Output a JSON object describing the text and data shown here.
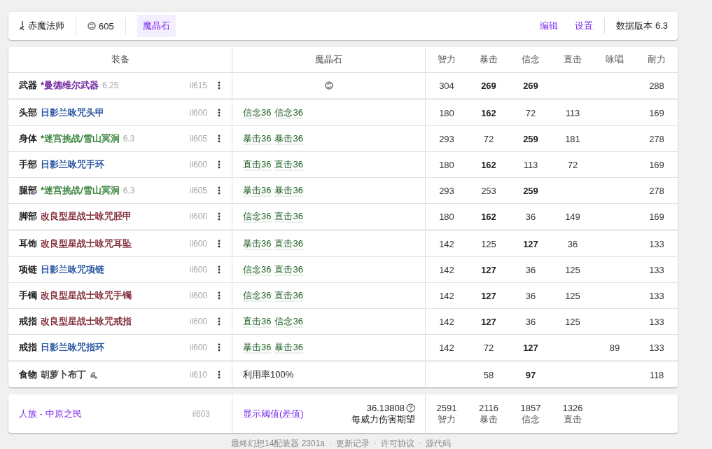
{
  "header": {
    "job": "赤魔法师",
    "item_level": "605",
    "tabs": [
      {
        "label": "魔晶石",
        "selected": true
      }
    ],
    "links": [
      "编辑",
      "设置"
    ],
    "data_version": "数据版本 6.3"
  },
  "table": {
    "columns": [
      "装备",
      "魔晶石",
      "智力",
      "暴击",
      "信念",
      "直击",
      "咏唱",
      "耐力"
    ],
    "groups": [
      [
        {
          "slot": "武器",
          "name": "*曼德维尔武器",
          "patch": "6.25",
          "color": "#6a1b9a",
          "hq": false,
          "ilvl": "il615",
          "materia": {
            "kind": "slot-icon"
          },
          "stats": {
            "intelligence": {
              "value": "304",
              "capped": false
            },
            "critical_hit": {
              "value": "269",
              "capped": true
            },
            "determination": {
              "value": "269",
              "capped": true
            },
            "vitality": {
              "value": "288",
              "capped": false
            }
          }
        }
      ],
      [
        {
          "slot": "头部",
          "name": "日影兰咏咒头甲",
          "color": "#1a4a9c",
          "hq": false,
          "ilvl": "il600",
          "materia": {
            "kind": "melds",
            "melds": [
              "信念36",
              "信念36"
            ]
          },
          "stats": {
            "intelligence": {
              "value": "180",
              "capped": false
            },
            "critical_hit": {
              "value": "162",
              "capped": true
            },
            "determination": {
              "value": "72",
              "capped": false
            },
            "direct_hit": {
              "value": "113",
              "capped": false
            },
            "vitality": {
              "value": "169",
              "capped": false
            }
          }
        },
        {
          "slot": "身体",
          "name": "*迷宫挑战/雪山冥洞",
          "patch": "6.3",
          "color": "#2e7d32",
          "hq": false,
          "ilvl": "il605",
          "materia": {
            "kind": "melds",
            "melds": [
              "暴击36",
              "暴击36"
            ]
          },
          "stats": {
            "intelligence": {
              "value": "293",
              "capped": false
            },
            "critical_hit": {
              "value": "72",
              "capped": false
            },
            "determination": {
              "value": "259",
              "capped": true
            },
            "direct_hit": {
              "value": "181",
              "capped": false
            },
            "vitality": {
              "value": "278",
              "capped": false
            }
          }
        },
        {
          "slot": "手部",
          "name": "日影兰咏咒手环",
          "color": "#1a4a9c",
          "hq": false,
          "ilvl": "il600",
          "materia": {
            "kind": "melds",
            "melds": [
              "直击36",
              "直击36"
            ]
          },
          "stats": {
            "intelligence": {
              "value": "180",
              "capped": false
            },
            "critical_hit": {
              "value": "162",
              "capped": true
            },
            "determination": {
              "value": "113",
              "capped": false
            },
            "direct_hit": {
              "value": "72",
              "capped": false
            },
            "vitality": {
              "value": "169",
              "capped": false
            }
          }
        },
        {
          "slot": "腿部",
          "name": "*迷宫挑战/雪山冥洞",
          "patch": "6.3",
          "color": "#2e7d32",
          "hq": false,
          "ilvl": "il605",
          "materia": {
            "kind": "melds",
            "melds": [
              "暴击36",
              "暴击36"
            ]
          },
          "stats": {
            "intelligence": {
              "value": "293",
              "capped": false
            },
            "critical_hit": {
              "value": "253",
              "capped": false
            },
            "determination": {
              "value": "259",
              "capped": true
            },
            "vitality": {
              "value": "278",
              "capped": false
            }
          }
        },
        {
          "slot": "脚部",
          "name": "改良型星战士咏咒胫甲",
          "color": "#7a1f2b",
          "hq": false,
          "ilvl": "il600",
          "materia": {
            "kind": "melds",
            "melds": [
              "信念36",
              "直击36"
            ]
          },
          "stats": {
            "intelligence": {
              "value": "180",
              "capped": false
            },
            "critical_hit": {
              "value": "162",
              "capped": true
            },
            "determination": {
              "value": "36",
              "capped": false
            },
            "direct_hit": {
              "value": "149",
              "capped": false
            },
            "vitality": {
              "value": "169",
              "capped": false
            }
          }
        }
      ],
      [
        {
          "slot": "耳饰",
          "name": "改良型星战士咏咒耳坠",
          "color": "#7a1f2b",
          "hq": false,
          "ilvl": "il600",
          "materia": {
            "kind": "melds",
            "melds": [
              "暴击36",
              "直击36"
            ]
          },
          "stats": {
            "intelligence": {
              "value": "142",
              "capped": false
            },
            "critical_hit": {
              "value": "125",
              "capped": false
            },
            "determination": {
              "value": "127",
              "capped": true
            },
            "direct_hit": {
              "value": "36",
              "capped": false
            },
            "vitality": {
              "value": "133",
              "capped": false
            }
          }
        },
        {
          "slot": "项链",
          "name": "日影兰咏咒项链",
          "color": "#1a4a9c",
          "hq": false,
          "ilvl": "il600",
          "materia": {
            "kind": "melds",
            "melds": [
              "信念36",
              "直击36"
            ]
          },
          "stats": {
            "intelligence": {
              "value": "142",
              "capped": false
            },
            "critical_hit": {
              "value": "127",
              "capped": true
            },
            "determination": {
              "value": "36",
              "capped": false
            },
            "direct_hit": {
              "value": "125",
              "capped": false
            },
            "vitality": {
              "value": "133",
              "capped": false
            }
          }
        },
        {
          "slot": "手镯",
          "name": "改良型星战士咏咒手镯",
          "color": "#7a1f2b",
          "hq": false,
          "ilvl": "il600",
          "materia": {
            "kind": "melds",
            "melds": [
              "信念36",
              "直击36"
            ]
          },
          "stats": {
            "intelligence": {
              "value": "142",
              "capped": false
            },
            "critical_hit": {
              "value": "127",
              "capped": true
            },
            "determination": {
              "value": "36",
              "capped": false
            },
            "direct_hit": {
              "value": "125",
              "capped": false
            },
            "vitality": {
              "value": "133",
              "capped": false
            }
          }
        },
        {
          "slot": "戒指",
          "name": "改良型星战士咏咒戒指",
          "color": "#7a1f2b",
          "hq": false,
          "ilvl": "il600",
          "materia": {
            "kind": "melds",
            "melds": [
              "直击36",
              "信念36"
            ]
          },
          "stats": {
            "intelligence": {
              "value": "142",
              "capped": false
            },
            "critical_hit": {
              "value": "127",
              "capped": true
            },
            "determination": {
              "value": "36",
              "capped": false
            },
            "direct_hit": {
              "value": "125",
              "capped": false
            },
            "vitality": {
              "value": "133",
              "capped": false
            }
          }
        },
        {
          "slot": "戒指",
          "name": "日影兰咏咒指环",
          "color": "#1a4a9c",
          "hq": false,
          "ilvl": "il600",
          "materia": {
            "kind": "melds",
            "melds": [
              "暴击36",
              "暴击36"
            ]
          },
          "stats": {
            "intelligence": {
              "value": "142",
              "capped": false
            },
            "critical_hit": {
              "value": "72",
              "capped": false
            },
            "determination": {
              "value": "127",
              "capped": true
            },
            "spell_speed": {
              "value": "89",
              "capped": false
            },
            "vitality": {
              "value": "133",
              "capped": false
            }
          }
        }
      ],
      [
        {
          "slot": "食物",
          "name": "胡萝卜布丁",
          "color": "#333333",
          "hq": true,
          "ilvl": "il610",
          "materia": {
            "kind": "text",
            "text": "利用率100%"
          },
          "stats": {
            "critical_hit": {
              "value": "58",
              "capped": false
            },
            "determination": {
              "value": "97",
              "capped": true
            },
            "vitality": {
              "value": "118",
              "capped": false
            }
          }
        }
      ]
    ]
  },
  "summary": {
    "race": "人族 - 中原之民",
    "ilvl": "il603",
    "threshold_link": "显示阈值(差值)",
    "damage": {
      "value": "36.13808",
      "label": "每威力伤害期望"
    },
    "totals": [
      {
        "value": "2591",
        "label": "智力"
      },
      {
        "value": "2116",
        "label": "暴击"
      },
      {
        "value": "1857",
        "label": "信念"
      },
      {
        "value": "1326",
        "label": "直击"
      }
    ]
  },
  "footer": {
    "items": [
      "最终幻想14配装器 2301a",
      "更新记录",
      "许可协议",
      "源代码"
    ],
    "separator": "·"
  }
}
